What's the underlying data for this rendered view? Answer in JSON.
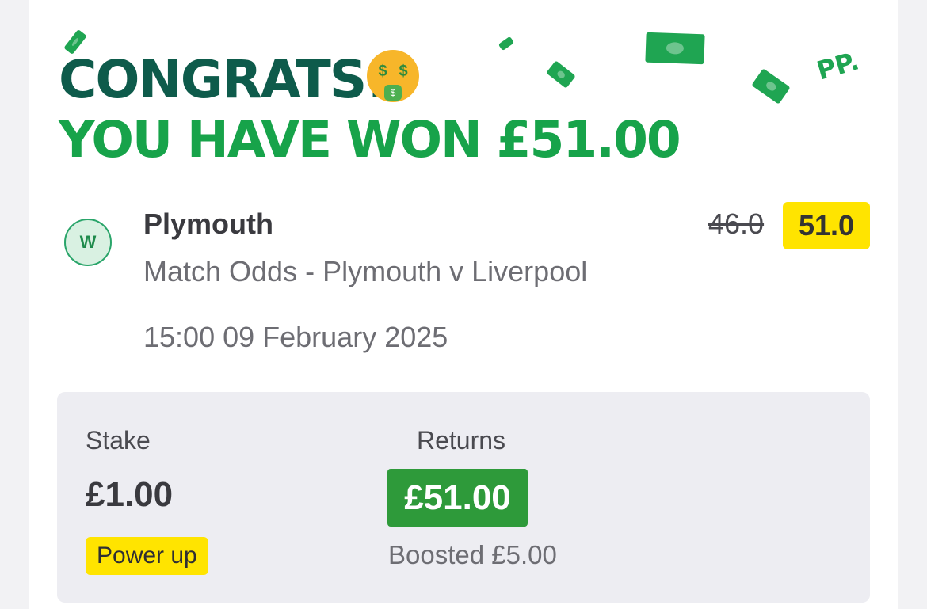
{
  "header": {
    "line1": "CONGRATS!",
    "line2": "YOU HAVE WON £51.00",
    "emoji": "money-mouth-face",
    "brand_mark": "PP."
  },
  "bet": {
    "result_badge": "W",
    "selection": "Plymouth",
    "market": "Match Odds - Plymouth v Liverpool",
    "datetime": "15:00 09 February 2025",
    "original_odds": "46.0",
    "boosted_odds": "51.0"
  },
  "summary": {
    "stake_label": "Stake",
    "stake_value": "£1.00",
    "returns_label": "Returns",
    "returns_value": "£51.00",
    "power_up_label": "Power up",
    "boosted_text": "Boosted £5.00"
  },
  "colors": {
    "brand_dark_green": "#0e5b4b",
    "brand_green": "#17a34a",
    "highlight_yellow": "#ffe400",
    "returns_green": "#2e9a3a"
  }
}
